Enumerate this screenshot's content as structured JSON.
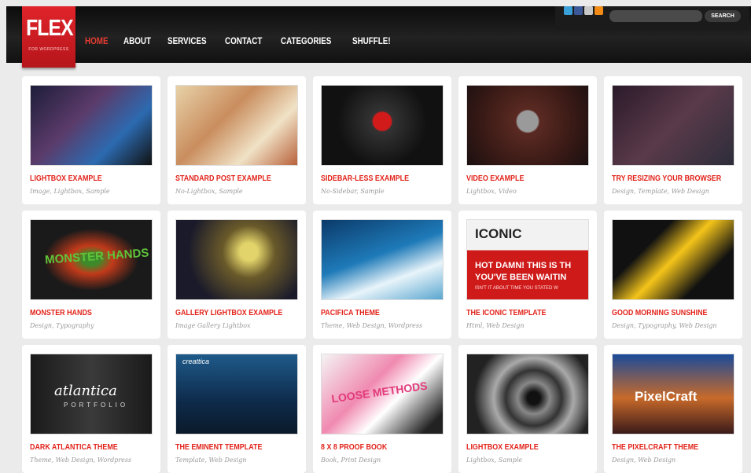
{
  "logo": {
    "main": "FLEX",
    "sub": "FOR WORDPRESS"
  },
  "nav": {
    "items": [
      "HOME",
      "ABOUT",
      "SERVICES",
      "CONTACT",
      "CATEGORIES",
      "SHUFFLE!"
    ],
    "active": 0
  },
  "search": {
    "placeholder": "",
    "button": "SEARCH"
  },
  "social": [
    {
      "icon": "twitter-icon",
      "color": "#3aa0d9"
    },
    {
      "icon": "facebook-icon",
      "color": "#3b5998"
    },
    {
      "icon": "email-icon",
      "color": "#c9c9c9"
    },
    {
      "icon": "rss-icon",
      "color": "#f28a16"
    }
  ],
  "accent": "#e2231a",
  "posts": [
    {
      "title": "LIGHTBOX EXAMPLE",
      "tags": "Image, Lightbox, Sample",
      "bg": "linear-gradient(135deg,#1d1d3a,#5b3b6a 40%,#2c6ab0 70%,#111)"
    },
    {
      "title": "STANDARD POST EXAMPLE",
      "tags": "No-Lightbox, Sample",
      "bg": "linear-gradient(135deg,#e8d2a8,#c98d5e 40%,#f0e2c6 70%,#b8613a)"
    },
    {
      "title": "SIDEBAR-LESS EXAMPLE",
      "tags": "No-Sidebar, Sample",
      "bg": "radial-gradient(circle at 50% 45%,#d11b1b 12%,#333 14%,#111 60%)"
    },
    {
      "title": "VIDEO EXAMPLE",
      "tags": "Lightbox, Video",
      "bg": "radial-gradient(circle at 50% 45%,#9a9a9a 14%,#5a2a22 16%,#3a1a16 60%,#1a1010)"
    },
    {
      "title": "TRY RESIZING YOUR BROWSER",
      "tags": "Design, Template, Web Design",
      "bg": "linear-gradient(135deg,#2a1a2a,#5a3a4a 50%,#2d2d3a)"
    },
    {
      "title": "MONSTER HANDS",
      "tags": "Design, Typography",
      "bg": "radial-gradient(ellipse at 50% 50%,#3d8a2a 10%,#c23a1a 25%,#1a1a1a 55%)"
    },
    {
      "title": "GALLERY LIGHTBOX EXAMPLE",
      "tags": "Image Gallery Lightbox",
      "bg": "radial-gradient(circle at 60% 40%,#e2d46a 10%,#6a5a2a 30%,#1a1a2a 70%)"
    },
    {
      "title": "PACIFICA THEME",
      "tags": "Theme, Web Design, Wordpress",
      "bg": "linear-gradient(160deg,#0b3a6a,#1e7ab8 45%,#e8f4fa 70%,#5aa6cf)"
    },
    {
      "title": "THE ICONIC TEMPLATE",
      "tags": "Html, Web Design",
      "bg": "linear-gradient(#f2f2f2 38%,#cf1a1a 38%)"
    },
    {
      "title": "GOOD MORNING SUNSHINE",
      "tags": "Design, Typography, Web Design",
      "bg": "linear-gradient(135deg,#111 30%,#f4c41a 50%,#111 75%)"
    },
    {
      "title": "DARK ATLANTICA THEME",
      "tags": "Theme, Web Design, Wordpress",
      "bg": "linear-gradient(90deg,#1a1a1a,#3a3a3a 50%,#1a1a1a)"
    },
    {
      "title": "THE EMINENT TEMPLATE",
      "tags": "Template, Web Design",
      "bg": "linear-gradient(#1e5a8a,#0e2a4a 60%,#0a1a2a)"
    },
    {
      "title": "8 X 8 PROOF BOOK",
      "tags": "Book, Print Design",
      "bg": "linear-gradient(135deg,#f4f4f4,#f08ab0 40%,#fff 60%,#222 90%)"
    },
    {
      "title": "LIGHTBOX EXAMPLE",
      "tags": "Lightbox, Sample",
      "bg": "radial-gradient(circle at 55% 55%,#111 8%,#888 20%,#333 35%,#aaa 50%,#222 75%)"
    },
    {
      "title": "THE PIXELCRAFT THEME",
      "tags": "Design, Web Design",
      "bg": "linear-gradient(#1a4a9a,#c86a2a 55%,#3a1a1a)"
    }
  ],
  "thumb_texts": {
    "iconic": "ICONIC",
    "iconic_line1": "HOT DAMN! THIS IS TH",
    "iconic_line2": "YOU'VE BEEN WAITIN",
    "iconic_line3": "ISN'T IT ABOUT TIME YOU STATED W",
    "monster": "MONSTER HANDS",
    "atlantica": "atlantica",
    "atlantica_sub": "PORTFOLIO",
    "pixelcraft": "PixelCraft",
    "eminent": "creattica",
    "proof": "LOOSE METHODS"
  }
}
